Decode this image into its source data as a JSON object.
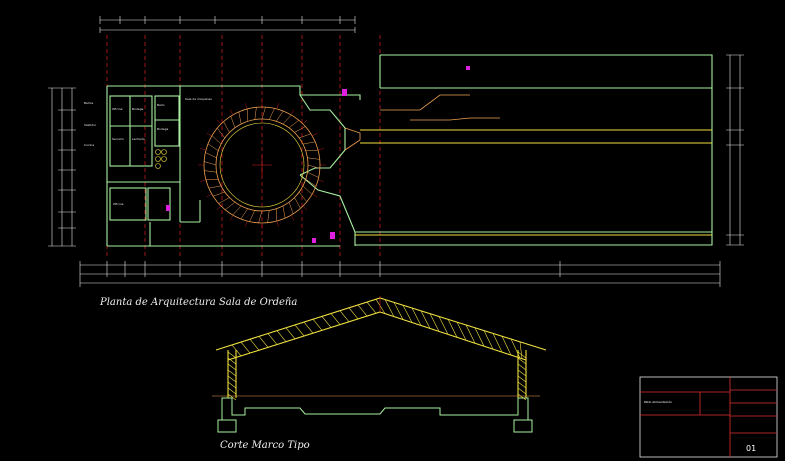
{
  "drawing": {
    "plan_title": "Planta de Arquitectura Sala de Ordeña",
    "section_title": "Corte Marco Tipo",
    "sheet_number": "01",
    "title_block_project": "Patio Alimentación"
  },
  "room_labels": [
    "Oficina",
    "Bodega",
    "Servicio",
    "Lechería",
    "Baño",
    "Bodega",
    "Oficina",
    "Sala de maquinas",
    "Baños",
    "Vestidor",
    "Cocina"
  ],
  "colors": {
    "background": "#000000",
    "walls": "#a8f0a0",
    "structure_yellow": "#f0e040",
    "column_lines": "#e02020",
    "dimension_lines": "#e8e8e8",
    "accent_magenta": "#e020e0",
    "title_block_red": "#e03030",
    "carousel_orange": "#f0a050"
  }
}
